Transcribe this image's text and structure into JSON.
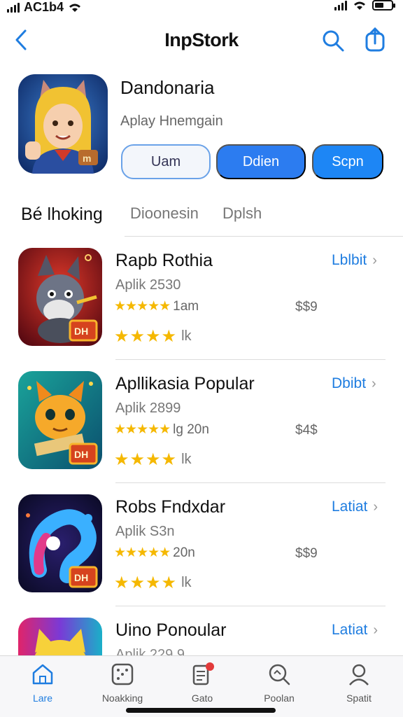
{
  "status": {
    "carrier": "AC1b4"
  },
  "nav": {
    "title": "InpStork"
  },
  "hero": {
    "title": "Dandonaria",
    "subtitle": "Aplay Hnemgain",
    "buttons": [
      "Uam",
      "Ddien",
      "Scpn"
    ]
  },
  "tabs": [
    "Bé lhoking",
    "Dioonesin",
    "Dplsh"
  ],
  "apps": [
    {
      "title": "Rapb Rothia",
      "subtitle": "Aplik 2530",
      "rating_text": "1am",
      "price": "$$9",
      "stars2_text": "lk",
      "action": "Lblbit"
    },
    {
      "title": "Apllikasia Popular",
      "subtitle": "Aplik 2899",
      "rating_text": "lg 20n",
      "price": "$4$",
      "stars2_text": "lk",
      "action": "Dbibt"
    },
    {
      "title": "Robs Fndxdar",
      "subtitle": "Aplik S3n",
      "rating_text": "20n",
      "price": "$$9",
      "stars2_text": "lk",
      "action": "Latiat"
    },
    {
      "title": "Uino Ponoular",
      "subtitle": "Aplik 229 9",
      "action": "Latiat"
    }
  ],
  "icon_badge": "DH",
  "tabbar": [
    {
      "label": "Lare",
      "icon": "home-icon",
      "active": true
    },
    {
      "label": "Noakking",
      "icon": "dice-icon",
      "active": false
    },
    {
      "label": "Gato",
      "icon": "list-badge-icon",
      "active": false
    },
    {
      "label": "Poolan",
      "icon": "search-circle-icon",
      "active": false
    },
    {
      "label": "Spatit",
      "icon": "person-icon",
      "active": false
    }
  ],
  "colors": {
    "accent": "#1f7de0",
    "button_blue": "#2c7cf0",
    "star": "#f5b800"
  }
}
